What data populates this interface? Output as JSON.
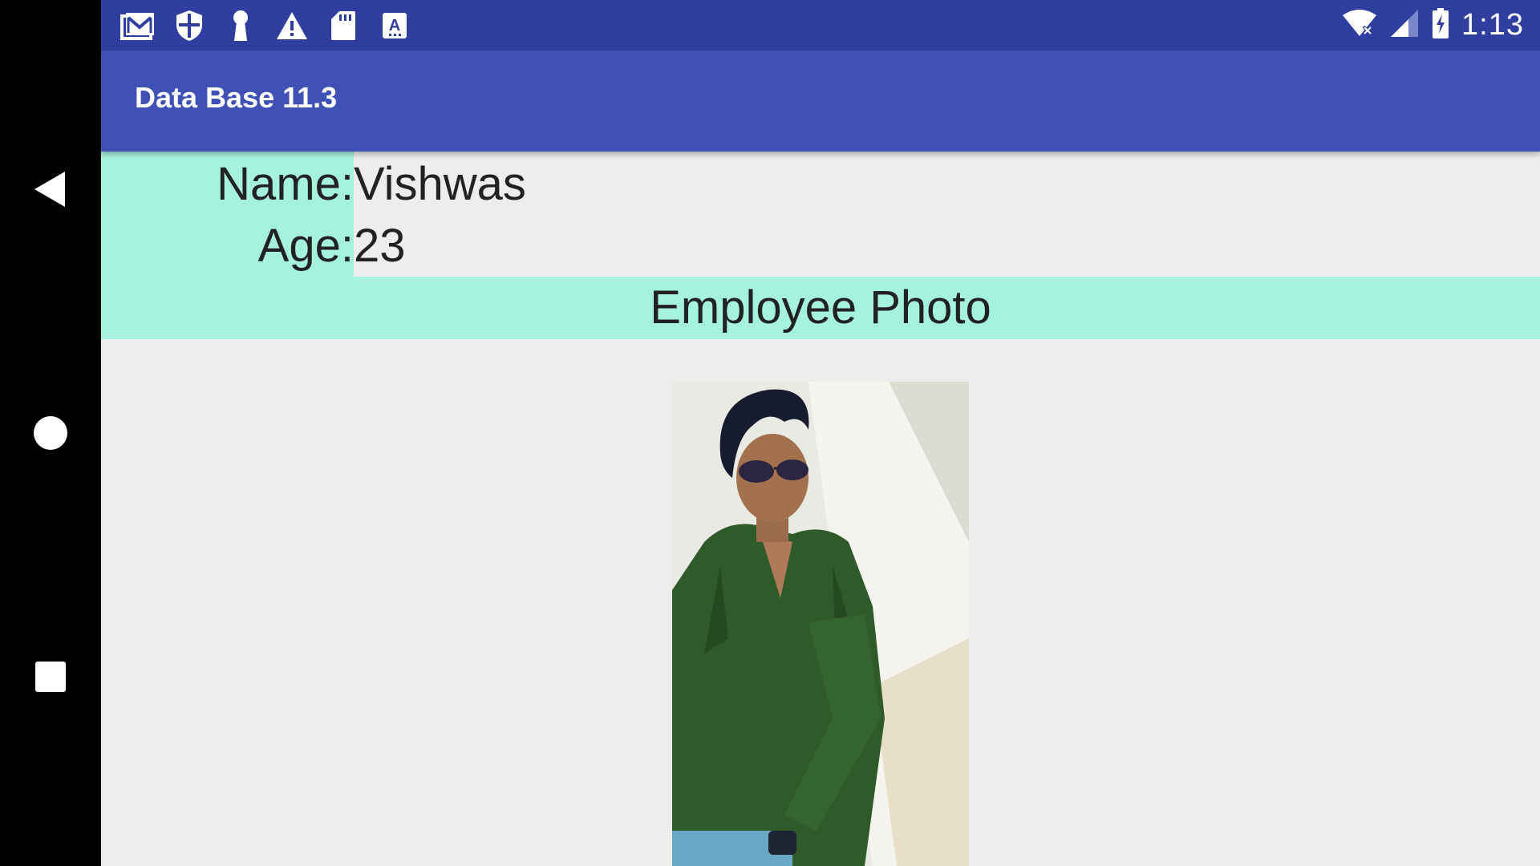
{
  "status_bar": {
    "time": "1:13",
    "notification_icons": [
      "gmail-icon",
      "shield-icon",
      "keyhole-icon",
      "warning-icon",
      "sd-card-icon",
      "font-a-icon"
    ],
    "system_icons": [
      "wifi-icon",
      "signal-icon",
      "battery-charging-icon"
    ]
  },
  "app_bar": {
    "title": "Data Base 11.3"
  },
  "employee": {
    "name_label": "Name:",
    "name_value": "Vishwas",
    "age_label": "Age:",
    "age_value": "23"
  },
  "photo_section": {
    "header": "Employee Photo"
  },
  "colors": {
    "status_bar": "#303f9f",
    "app_bar": "#3f51b5",
    "highlight": "#a5f2df",
    "background": "#ededed"
  }
}
